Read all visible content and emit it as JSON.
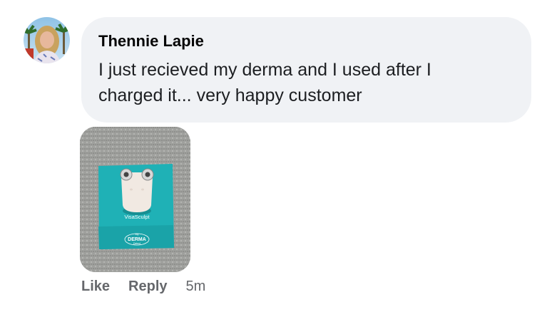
{
  "comment": {
    "author": "Thennie Lapie",
    "text": "I just recieved my derma and I used after I charged it... very happy customer",
    "attachment": {
      "product_name": "VisaSculpt",
      "brand_small": "My",
      "brand_main": "DERMA",
      "brand_sub": "Detect"
    },
    "actions": {
      "like": "Like",
      "reply": "Reply",
      "timestamp": "5m"
    }
  },
  "colors": {
    "bubble_bg": "#f0f2f5",
    "action_gray": "#65676b",
    "box_teal": "#1fb1b6",
    "author_text": "#050505"
  }
}
